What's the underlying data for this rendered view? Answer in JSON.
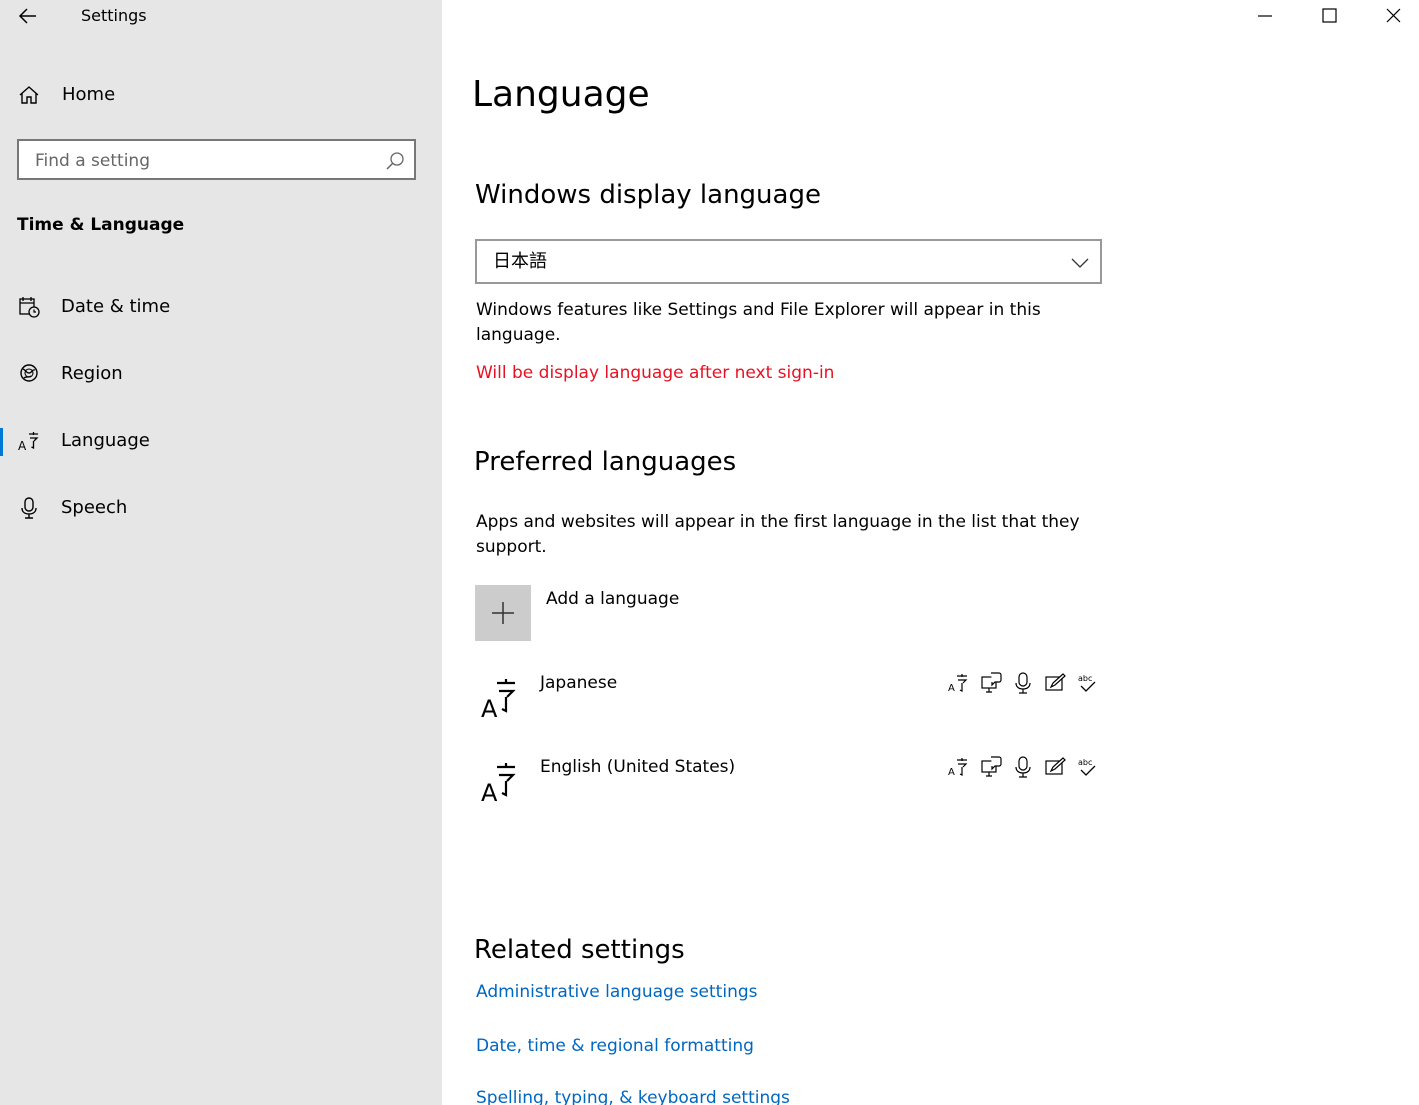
{
  "window": {
    "title": "Settings",
    "controls": [
      "minimize-icon",
      "maximize-icon",
      "close-icon"
    ]
  },
  "sidebar": {
    "home_label": "Home",
    "search_placeholder": "Find a setting",
    "section_label": "Time & Language",
    "items": [
      {
        "label": "Date & time",
        "icon": "calendar-clock-icon",
        "selected": false
      },
      {
        "label": "Region",
        "icon": "globe-icon",
        "selected": false
      },
      {
        "label": "Language",
        "icon": "language-icon",
        "selected": true
      },
      {
        "label": "Speech",
        "icon": "microphone-icon",
        "selected": false
      }
    ]
  },
  "main": {
    "title": "Language",
    "display_language": {
      "heading": "Windows display language",
      "selected": "日本語",
      "description": "Windows features like Settings and File Explorer will appear in this language.",
      "warning": "Will be display language after next sign-in",
      "warning_color": "#e81123"
    },
    "preferred": {
      "heading": "Preferred languages",
      "description": "Apps and websites will appear in the first language in the list that they support.",
      "add_label": "Add a language",
      "languages": [
        {
          "name": "Japanese",
          "features": [
            "display-language-icon",
            "text-to-speech-icon",
            "speech-recognition-icon",
            "handwriting-icon",
            "spellcheck-icon"
          ]
        },
        {
          "name": "English (United States)",
          "features": [
            "display-language-icon",
            "text-to-speech-icon",
            "speech-recognition-icon",
            "handwriting-icon",
            "spellcheck-icon"
          ]
        }
      ]
    },
    "related": {
      "heading": "Related settings",
      "links": [
        "Administrative language settings",
        "Date, time & regional formatting",
        "Spelling, typing, & keyboard settings"
      ],
      "link_color": "#0067c0"
    }
  },
  "colors": {
    "sidebar_bg": "#e6e6e6",
    "accent": "#0078d7"
  }
}
